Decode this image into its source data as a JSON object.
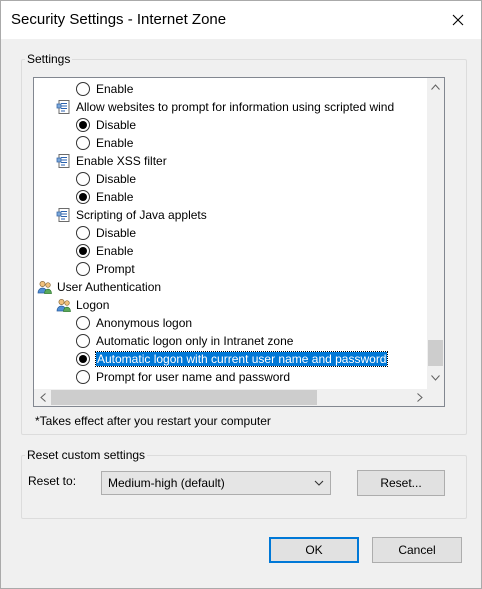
{
  "window": {
    "title": "Security Settings - Internet Zone"
  },
  "settings_group": {
    "label": "Settings"
  },
  "tree": {
    "rows": [
      {
        "kind": "radio",
        "label": "Enable",
        "checked": false
      },
      {
        "kind": "setting",
        "label": "Allow websites to prompt for information using scripted wind"
      },
      {
        "kind": "radio",
        "label": "Disable",
        "checked": true
      },
      {
        "kind": "radio",
        "label": "Enable",
        "checked": false
      },
      {
        "kind": "setting",
        "label": "Enable XSS filter"
      },
      {
        "kind": "radio",
        "label": "Disable",
        "checked": false
      },
      {
        "kind": "radio",
        "label": "Enable",
        "checked": true
      },
      {
        "kind": "setting",
        "label": "Scripting of Java applets"
      },
      {
        "kind": "radio",
        "label": "Disable",
        "checked": false
      },
      {
        "kind": "radio",
        "label": "Enable",
        "checked": true
      },
      {
        "kind": "radio",
        "label": "Prompt",
        "checked": false
      },
      {
        "kind": "category",
        "label": "User Authentication"
      },
      {
        "kind": "subcategory",
        "label": "Logon"
      },
      {
        "kind": "radio2",
        "label": "Anonymous logon",
        "checked": false
      },
      {
        "kind": "radio2",
        "label": "Automatic logon only in Intranet zone",
        "checked": false
      },
      {
        "kind": "radio2",
        "label": "Automatic logon with current user name and password",
        "checked": true,
        "selected": true
      },
      {
        "kind": "radio2",
        "label": "Prompt for user name and password",
        "checked": false
      }
    ]
  },
  "note": "*Takes effect after you restart your computer",
  "reset_group": {
    "label": "Reset custom settings",
    "reset_to_label": "Reset to:",
    "selected_value": "Medium-high (default)",
    "reset_button": "Reset..."
  },
  "buttons": {
    "ok": "OK",
    "cancel": "Cancel"
  },
  "colors": {
    "selection": "#0078d7",
    "default_button_border": "#0078d7"
  }
}
